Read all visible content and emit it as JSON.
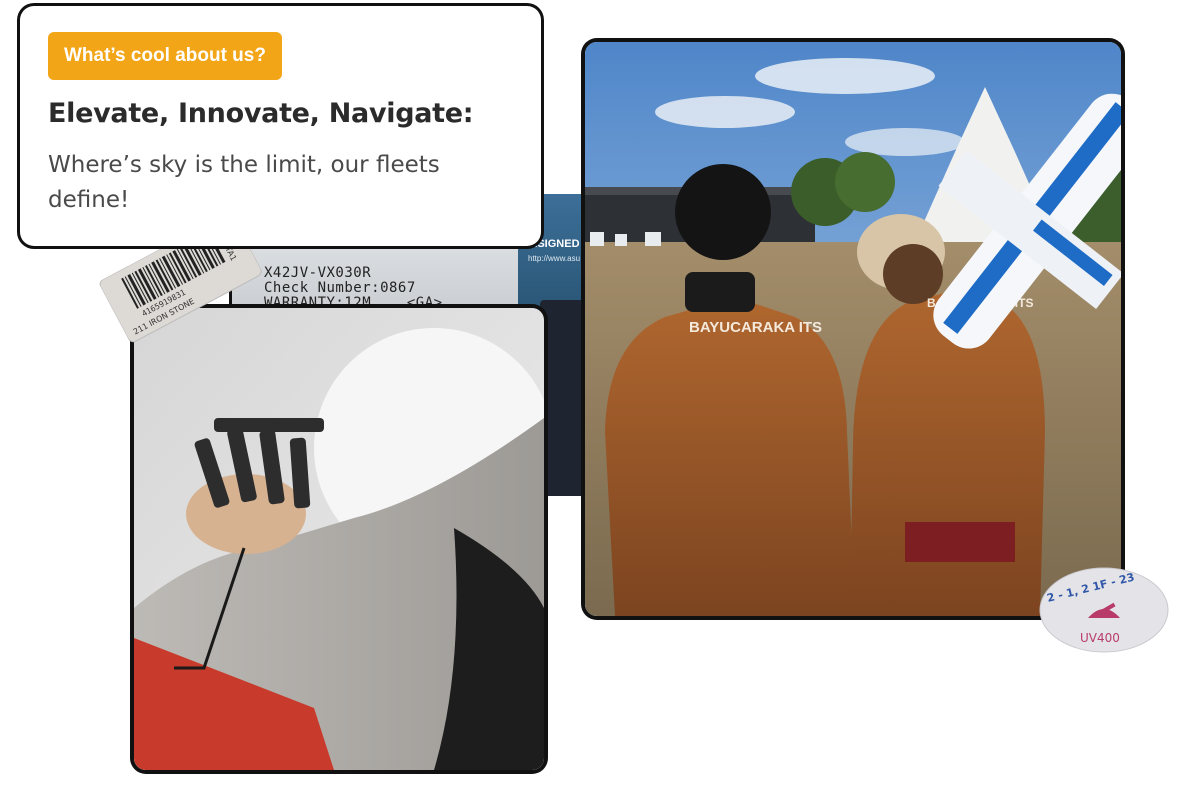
{
  "card": {
    "badge": "What’s cool about us?",
    "title": "Elevate, Innovate, Navigate:",
    "subtitle": "Where’s sky is the limit, our fleets define!"
  },
  "laptop_label": {
    "line1": "X42JV-VX030R",
    "line2": "Check Number:0867",
    "line3": "WARRANTY:12M    <GA>",
    "blue_text": "ESIGNED",
    "blue_url": "http://www.asu"
  },
  "jacket_text": "BAYUCARAKA ITS",
  "barcode_text": {
    "line1": "211 IRON STONE",
    "line2": "4165919831",
    "side": "TA1"
  },
  "uv_sticker": {
    "top": "2 - 1, 2   1F - 23",
    "bottom": "UV400"
  },
  "colors": {
    "badge": "#f2a516",
    "title": "#2b2b2b",
    "subtitle": "#4a4a4a",
    "frame": "#111111"
  }
}
